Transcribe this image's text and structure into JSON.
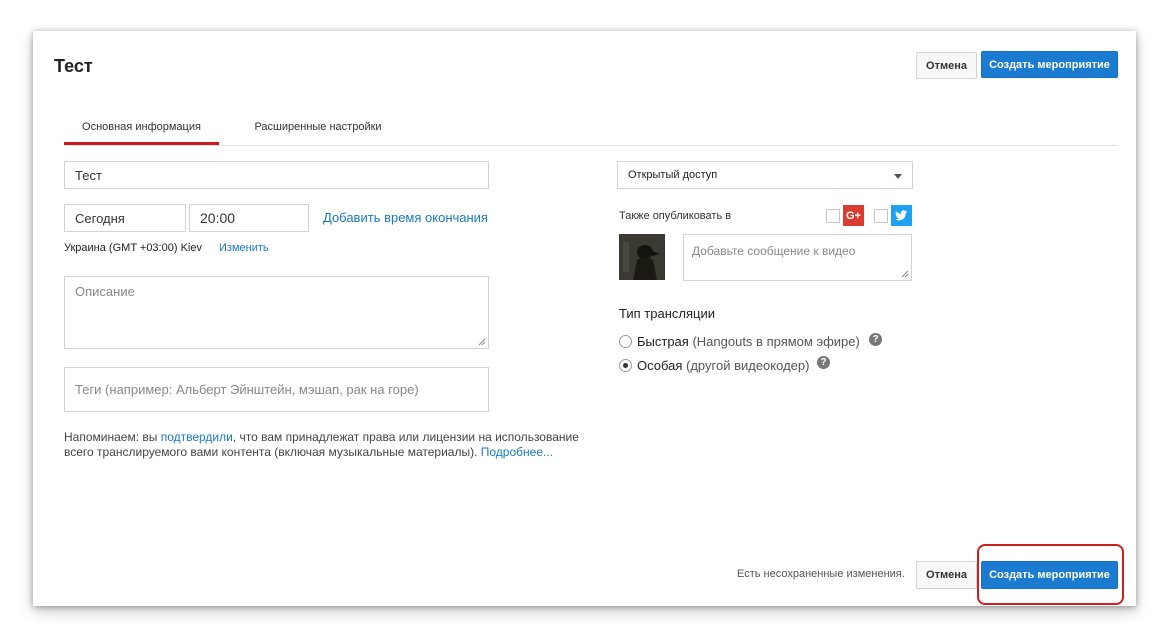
{
  "header": {
    "title": "Тест",
    "cancel_label": "Отмена",
    "create_label": "Создать мероприятие"
  },
  "tabs": [
    {
      "label": "Основная информация",
      "active": true
    },
    {
      "label": "Расширенные настройки",
      "active": false
    }
  ],
  "form": {
    "title_value": "Тест",
    "date_value": "Сегодня",
    "time_value": "20:00",
    "add_end_time_label": "Добавить время окончания",
    "timezone_text": "Украина (GMT +03:00) Kiev",
    "change_label": "Изменить",
    "description_placeholder": "Описание",
    "tags_placeholder": "Теги (например: Альберт Эйнштейн, мэшап, рак на горе)",
    "notice_prefix": "Напоминаем: вы ",
    "notice_link": "подтвердили",
    "notice_middle": ", что вам принадлежат права или лицензии на использование всего транслируемого вами контента (включая музыкальные материалы). ",
    "notice_more": "Подробнее..."
  },
  "right": {
    "privacy_value": "Открытый доступ",
    "also_publish_label": "Также опубликовать в",
    "share_placeholder": "Добавьте сообщение к видео",
    "broadcast_type_heading": "Тип трансляции",
    "option_quick_bold": "Быстрая",
    "option_quick_rest": " (Hangouts в прямом эфире)",
    "option_custom_bold": "Особая",
    "option_custom_rest": " (другой видеокодер)",
    "help_glyph": "?",
    "gplus_glyph": "G+"
  },
  "footer": {
    "unsaved_text": "Есть несохраненные изменения.",
    "cancel_label": "Отмена",
    "create_label": "Создать мероприятие"
  },
  "colors": {
    "accent_blue": "#1b7bd1",
    "link_blue": "#167ac6",
    "tab_red": "#cc181e",
    "gplus_red": "#d73d32",
    "twitter_blue": "#1da1f2",
    "highlight_red": "#d01f1f"
  },
  "icons": [
    "dropdown-arrow-icon",
    "google-plus-icon",
    "twitter-icon",
    "help-icon",
    "resize-handle-icon",
    "avatar"
  ]
}
